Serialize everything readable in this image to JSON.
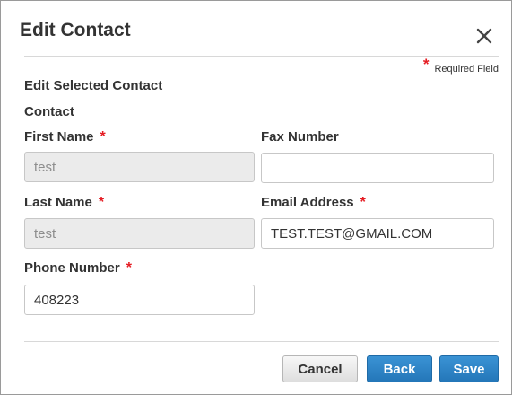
{
  "dialog": {
    "title": "Edit Contact",
    "required_note": "Required Field",
    "required_marker": "*",
    "section_heading": "Edit Selected Contact",
    "group_label": "Contact"
  },
  "fields": {
    "first_name": {
      "label": "First Name",
      "value": "test",
      "required": true,
      "disabled": true
    },
    "fax_number": {
      "label": "Fax Number",
      "value": "",
      "required": false,
      "disabled": false
    },
    "last_name": {
      "label": "Last Name",
      "value": "test",
      "required": true,
      "disabled": true
    },
    "email_address": {
      "label": "Email Address",
      "value": "TEST.TEST@GMAIL.COM",
      "required": true,
      "disabled": false
    },
    "phone_number": {
      "label": "Phone Number",
      "value": "408223",
      "required": true,
      "disabled": false
    }
  },
  "buttons": {
    "cancel": "Cancel",
    "back": "Back",
    "save": "Save"
  },
  "icons": {
    "close": "close-icon"
  },
  "colors": {
    "required_star": "#e51c23",
    "primary_button": "#2a81c6",
    "disabled_input": "#ebebeb"
  }
}
